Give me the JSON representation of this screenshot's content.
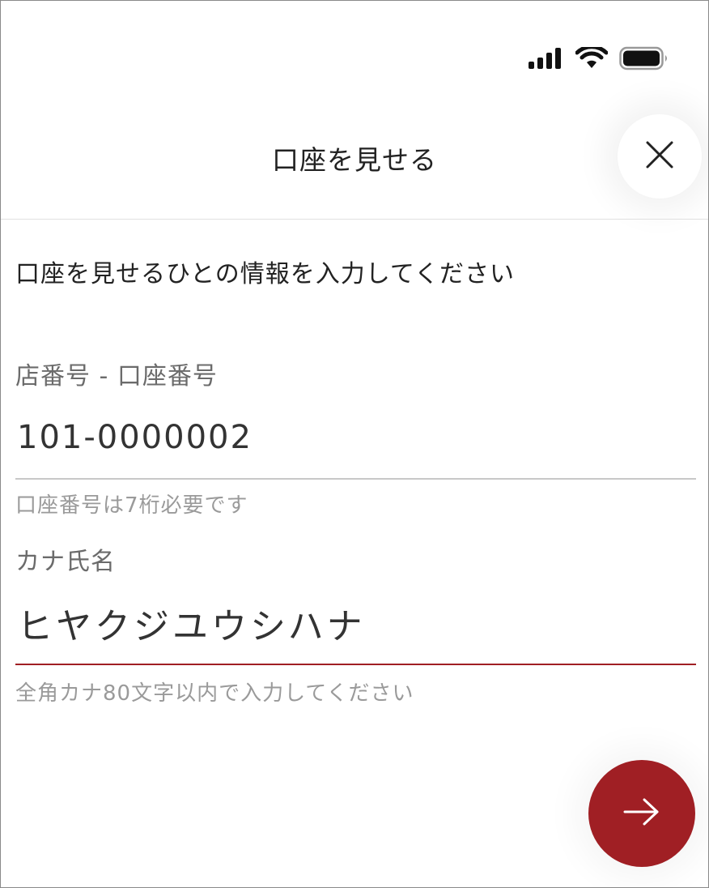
{
  "colors": {
    "accent": "#a01f24",
    "text_primary": "#222222",
    "text_label": "#6b6b6b",
    "text_hint": "#9a9a9a",
    "line_default": "#c8c8c8"
  },
  "status_bar": {
    "icons": [
      "cellular-signal-icon",
      "wifi-icon",
      "battery-icon"
    ]
  },
  "header": {
    "title": "口座を見せる",
    "close_icon": "close-icon"
  },
  "instruction": "口座を見せるひとの情報を入力してください",
  "form": {
    "account": {
      "label": "店番号 - 口座番号",
      "value": "101-0000002",
      "hint": "口座番号は7桁必要です"
    },
    "kana_name": {
      "label": "カナ氏名",
      "value": "ヒヤクジユウシハナ",
      "hint": "全角カナ80文字以内で入力してください"
    }
  },
  "next_button": {
    "icon": "arrow-right-icon"
  }
}
